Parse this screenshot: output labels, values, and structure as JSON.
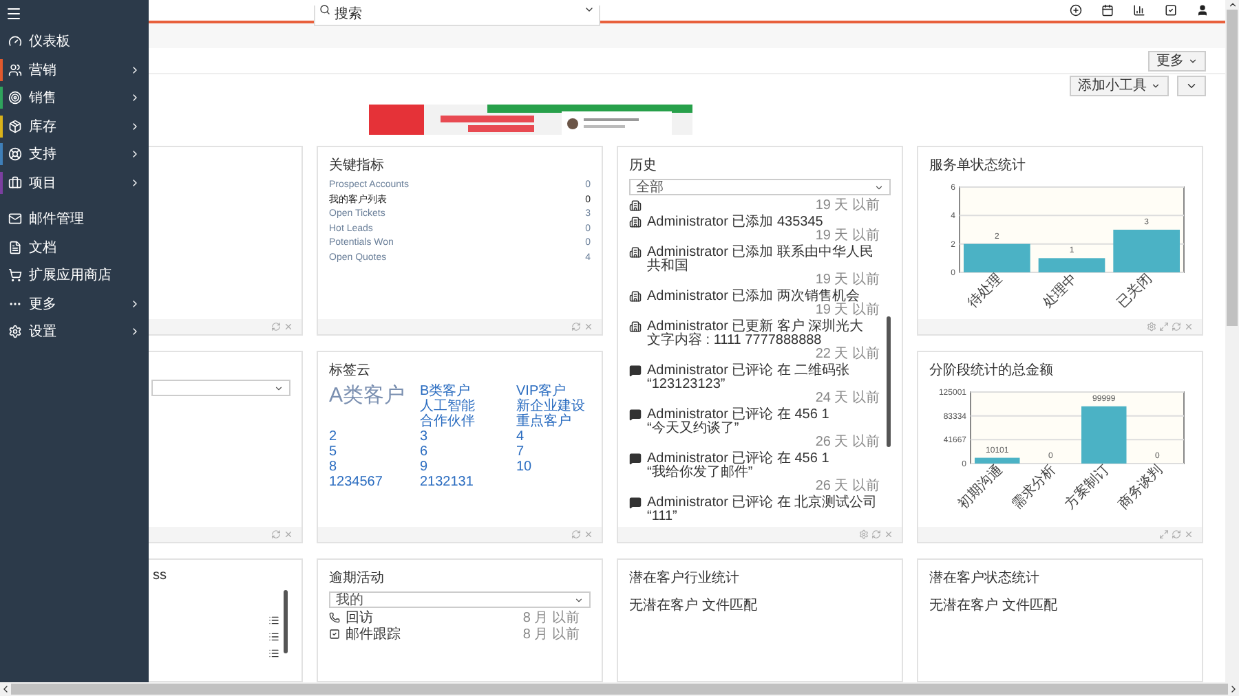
{
  "sidebar": {
    "items": [
      {
        "label": "仪表板",
        "expandable": false
      },
      {
        "label": "营销",
        "expandable": true,
        "color": "#e0592d"
      },
      {
        "label": "销售",
        "expandable": true,
        "color": "#2fa35c"
      },
      {
        "label": "库存",
        "expandable": true,
        "color": "#d9b21a"
      },
      {
        "label": "支持",
        "expandable": true,
        "color": "#3f7fb8"
      },
      {
        "label": "项目",
        "expandable": true,
        "color": "#7b3fa0"
      },
      {
        "label": "邮件管理",
        "expandable": false
      },
      {
        "label": "文档",
        "expandable": false
      },
      {
        "label": "扩展应用商店",
        "expandable": false
      },
      {
        "label": "更多",
        "expandable": true
      },
      {
        "label": "设置",
        "expandable": true
      }
    ]
  },
  "search": {
    "placeholder": "搜索"
  },
  "more_button": "更多",
  "add_widget_button": "添加小工具",
  "side_widget": {
    "title": "ss"
  },
  "key_metrics": {
    "title": "关键指标",
    "rows": [
      {
        "label": "Prospect Accounts",
        "count": "0",
        "emphasis": false
      },
      {
        "label": "我的客户列表",
        "count": "0",
        "emphasis": true
      },
      {
        "label": "Open Tickets",
        "count": "3",
        "emphasis": false
      },
      {
        "label": "Hot Leads",
        "count": "0",
        "emphasis": false
      },
      {
        "label": "Potentials Won",
        "count": "0",
        "emphasis": false
      },
      {
        "label": "Open Quotes",
        "count": "4",
        "emphasis": false
      }
    ]
  },
  "history": {
    "title": "历史",
    "filter": "全部",
    "entries": [
      {
        "kind": "record",
        "time": "19 天 以前"
      },
      {
        "kind": "record",
        "text": "Administrator 已添加 435345",
        "time": "19 天 以前"
      },
      {
        "kind": "record",
        "text": "Administrator 已添加 联系由中华人民共和国",
        "time": "19 天 以前"
      },
      {
        "kind": "record",
        "text": "Administrator 已添加 两次销售机会",
        "time": "19 天 以前"
      },
      {
        "kind": "record",
        "text": "Administrator 已更新 客户 深圳光大",
        "quote": "文字内容 : 1111 7777888888",
        "time": "22 天 以前"
      },
      {
        "kind": "comment",
        "text": "Administrator 已评论 在 二维码张",
        "quote": "“123123123”",
        "time": "24 天 以前"
      },
      {
        "kind": "comment",
        "text": "Administrator 已评论 在 456 1",
        "quote": "“今天又约谈了”",
        "time": "26 天 以前"
      },
      {
        "kind": "comment",
        "text": "Administrator 已评论 在 456 1",
        "quote": "“我给你发了邮件”",
        "time": "26 天 以前"
      },
      {
        "kind": "comment",
        "text": "Administrator 已评论 在 北京测试公司",
        "quote": "“111”"
      }
    ]
  },
  "service_chart": {
    "chart_data": {
      "type": "bar",
      "title": "服务单状态统计",
      "categories": [
        "待处理",
        "处理中",
        "已关闭"
      ],
      "series": [
        {
          "color": "#4bb2c5",
          "values": [
            2,
            1,
            3
          ]
        }
      ],
      "ylim": [
        0,
        6
      ],
      "yticks": [
        0,
        2,
        4,
        6
      ],
      "data_labels": true
    }
  },
  "tag_cloud": {
    "title": "标签云",
    "tags": [
      {
        "label": "A类客户",
        "big": true
      },
      {
        "label": "B类客户",
        "big": false
      },
      {
        "label": "VIP客户",
        "big": false
      },
      {
        "label": "人工智能",
        "big": false
      },
      {
        "label": "新企业建设",
        "big": false
      },
      {
        "label": "合作伙伴",
        "big": false
      },
      {
        "label": "重点客户",
        "big": false
      },
      {
        "label": "2",
        "big": false
      },
      {
        "label": "3",
        "big": false
      },
      {
        "label": "4",
        "big": false
      },
      {
        "label": "5",
        "big": false
      },
      {
        "label": "6",
        "big": false
      },
      {
        "label": "7",
        "big": false
      },
      {
        "label": "8",
        "big": false
      },
      {
        "label": "9",
        "big": false
      },
      {
        "label": "10",
        "big": false
      },
      {
        "label": "1234567",
        "big": false
      },
      {
        "label": "2132131",
        "big": false
      }
    ]
  },
  "stage_chart": {
    "chart_data": {
      "type": "bar",
      "title": "分阶段统计的总金额",
      "categories": [
        "初期沟通",
        "需求分析",
        "方案制订",
        "商务谈判"
      ],
      "series": [
        {
          "color": "#4bb2c5",
          "values": [
            10101,
            0,
            99999,
            0
          ]
        }
      ],
      "ylim": [
        0,
        125001
      ],
      "yticks": [
        0,
        41667,
        83334,
        125001
      ],
      "data_labels": true
    }
  },
  "overdue": {
    "title": "逾期活动",
    "filter": "我的",
    "items": [
      {
        "kind": "call",
        "label": "回访",
        "time": "8 月 以前"
      },
      {
        "kind": "task",
        "label": "邮件跟踪",
        "time": "8 月 以前"
      }
    ]
  },
  "lead_industry": {
    "title": "潜在客户行业统计",
    "message": "无潜在客户 文件匹配"
  },
  "lead_status": {
    "title": "潜在客户状态统计",
    "message": "无潜在客户 文件匹配"
  }
}
